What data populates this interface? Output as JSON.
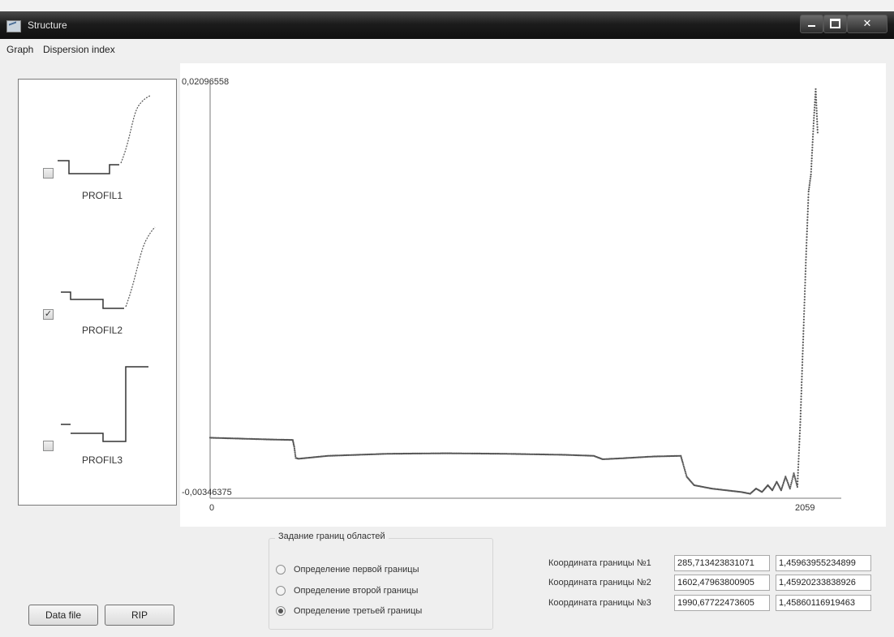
{
  "window": {
    "title": "Structure"
  },
  "menu": {
    "items": [
      "Graph",
      "Dispersion index"
    ]
  },
  "profiles": [
    {
      "label": "PROFIL1",
      "checked": false
    },
    {
      "label": "PROFIL2",
      "checked": true
    },
    {
      "label": "PROFIL3",
      "checked": false
    }
  ],
  "chart_data": {
    "type": "scatter",
    "y_max_label": "0,02096558",
    "y_min_label": "-0,00346375",
    "x_min_label": "0",
    "x_max_label": "2059",
    "xlim": [
      0,
      2059
    ],
    "ylim": [
      -0.00346375,
      0.02096558
    ],
    "series": [
      {
        "color": "#555555",
        "points": [
          [
            0,
            8e-05
          ],
          [
            100,
            3e-05
          ],
          [
            200,
            -2e-05
          ],
          [
            280,
            -5e-05
          ],
          [
            285,
            -0.00045
          ],
          [
            290,
            -0.0011
          ],
          [
            300,
            -0.00115
          ],
          [
            400,
            -0.00098
          ],
          [
            600,
            -0.00086
          ],
          [
            800,
            -0.00083
          ],
          [
            1000,
            -0.00086
          ],
          [
            1200,
            -0.00092
          ],
          [
            1300,
            -0.00098
          ],
          [
            1330,
            -0.00118
          ],
          [
            1400,
            -0.00112
          ],
          [
            1500,
            -0.00102
          ],
          [
            1595,
            -0.00098
          ],
          [
            1602,
            -0.0014
          ],
          [
            1615,
            -0.0022
          ],
          [
            1640,
            -0.0027
          ],
          [
            1700,
            -0.0029
          ],
          [
            1750,
            -0.003
          ],
          [
            1800,
            -0.0031
          ],
          [
            1830,
            -0.0032
          ],
          [
            1850,
            -0.0029
          ],
          [
            1870,
            -0.0031
          ],
          [
            1890,
            -0.0027
          ],
          [
            1905,
            -0.003
          ],
          [
            1920,
            -0.0025
          ],
          [
            1935,
            -0.003
          ],
          [
            1950,
            -0.0022
          ],
          [
            1965,
            -0.0029
          ],
          [
            1978,
            -0.002
          ],
          [
            1990,
            -0.0028
          ],
          [
            2000,
            0.001
          ],
          [
            2010,
            0.006
          ],
          [
            2020,
            0.011
          ],
          [
            2028,
            0.0145
          ],
          [
            2036,
            0.0155
          ],
          [
            2045,
            0.0185
          ],
          [
            2052,
            0.0205
          ],
          [
            2059,
            0.0178
          ]
        ]
      }
    ]
  },
  "group": {
    "title": "Задание границ областей",
    "options": [
      {
        "label": "Определение первой границы",
        "selected": false
      },
      {
        "label": "Определение второй границы",
        "selected": false
      },
      {
        "label": "Определение третьей границы",
        "selected": true
      }
    ]
  },
  "coordinates": [
    {
      "label": "Координата границы №1",
      "x": "285,713423831071",
      "y": "1,45963955234899"
    },
    {
      "label": "Координата границы №2",
      "x": "1602,47963800905",
      "y": "1,45920233838926"
    },
    {
      "label": "Координата границы №3",
      "x": "1990,67722473605",
      "y": "1,45860116919463"
    }
  ],
  "buttons": {
    "data_file": "Data file",
    "rip": "RIP"
  }
}
